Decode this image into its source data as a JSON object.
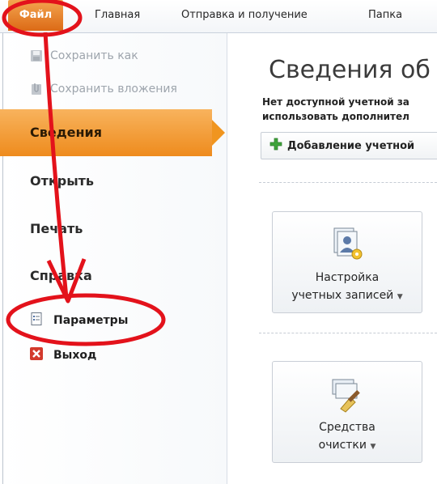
{
  "ribbon": {
    "tabs": [
      "Файл",
      "Главная",
      "Отправка и получение",
      "Папка"
    ]
  },
  "backstage": {
    "commands": [
      {
        "label": "Сохранить как",
        "icon": "save-as-icon"
      },
      {
        "label": "Сохранить вложения",
        "icon": "save-attachments-icon"
      }
    ],
    "nav": [
      "Сведения",
      "Открыть",
      "Печать",
      "Справка"
    ],
    "active_nav": "Сведения",
    "sub_items": [
      {
        "label": "Параметры",
        "icon": "options-icon"
      },
      {
        "label": "Выход",
        "icon": "exit-icon"
      }
    ]
  },
  "info": {
    "title": "Сведения об у",
    "line1": "Нет доступной учетной за",
    "line2": "использовать дополнител",
    "add_account": "Добавление учетной",
    "account_settings_line1": "Настройка",
    "account_settings_line2": "учетных записей",
    "cleanup_line1": "Средства",
    "cleanup_line2": "очистки"
  },
  "colors": {
    "file_tab": "#e0711c",
    "active_nav": "#f0951f",
    "annotation": "#e3121b"
  }
}
